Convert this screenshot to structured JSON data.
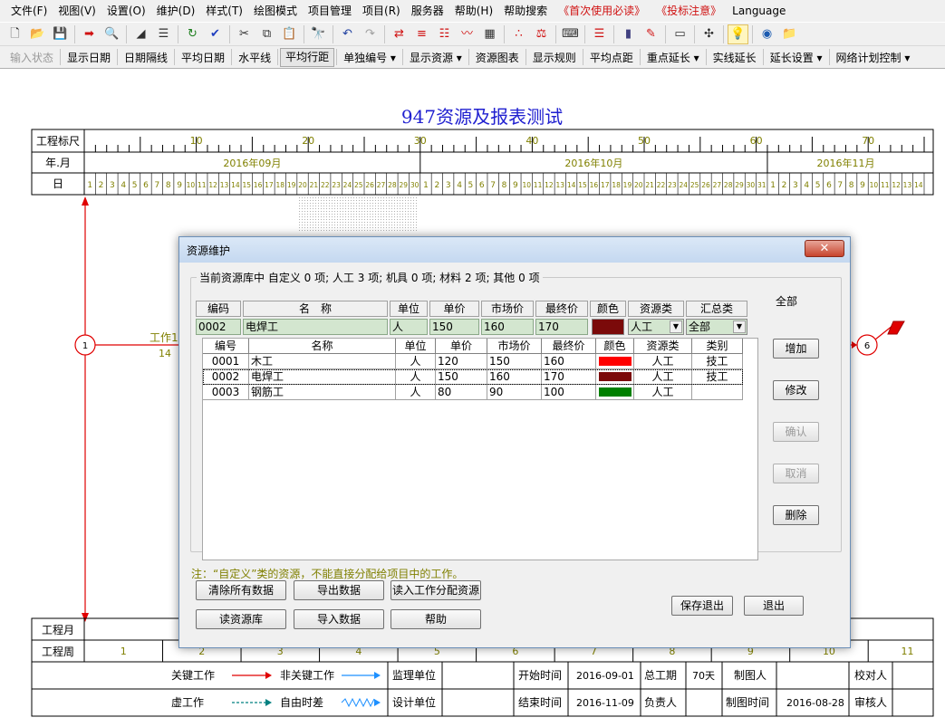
{
  "menu": {
    "items": [
      {
        "label": "文件(F)",
        "red": false
      },
      {
        "label": "视图(V)",
        "red": false
      },
      {
        "label": "设置(O)",
        "red": false
      },
      {
        "label": "维护(D)",
        "red": false
      },
      {
        "label": "样式(T)",
        "red": false
      },
      {
        "label": "绘图模式",
        "red": false
      },
      {
        "label": "项目管理",
        "red": false
      },
      {
        "label": "项目(R)",
        "red": false
      },
      {
        "label": "服务器",
        "red": false
      },
      {
        "label": "帮助(H)",
        "red": false
      },
      {
        "label": "帮助搜索",
        "red": false
      },
      {
        "label": "《首次使用必读》",
        "red": true
      },
      {
        "label": "《投标注意》",
        "red": true
      },
      {
        "label": "Language",
        "red": false
      }
    ]
  },
  "toolbar1": {
    "icons": [
      "new-icon",
      "open-icon",
      "save-icon",
      "|",
      "export-icon",
      "preview-icon",
      "|",
      "line-style-icon",
      "indent-icon",
      "|",
      "refresh-icon",
      "check-icon",
      "|",
      "cut-icon",
      "copy-icon",
      "paste-icon",
      "|",
      "find-icon",
      "|",
      "undo-icon",
      "redo-icon",
      "|",
      "network-icon",
      "layer-icon",
      "list-icon",
      "curve-icon",
      "resource-icon",
      "|",
      "calc-icon",
      "balance-icon",
      "|",
      "tool-icon",
      "|",
      "gantt-icon",
      "|",
      "chart-icon",
      "edit-icon",
      "|",
      "monitor-icon",
      "|",
      "connect-icon",
      "|",
      "bulb-icon",
      "|",
      "globe-icon",
      "folder-icon"
    ]
  },
  "toolbar2": {
    "items": [
      {
        "label": "输入状态",
        "gray": true,
        "pressed": false
      },
      {
        "label": "显示日期",
        "gray": false,
        "pressed": false
      },
      {
        "label": "日期隔线",
        "gray": false,
        "pressed": false
      },
      {
        "label": "平均日期",
        "gray": false,
        "pressed": false
      },
      {
        "label": "水平线",
        "gray": false,
        "pressed": false
      },
      {
        "label": "平均行距",
        "gray": false,
        "pressed": true
      },
      {
        "label": "单独编号 ▾",
        "gray": false,
        "pressed": false
      },
      {
        "label": "显示资源 ▾",
        "gray": false,
        "pressed": false
      },
      {
        "label": "资源图表",
        "gray": false,
        "pressed": false
      },
      {
        "label": "显示规则",
        "gray": false,
        "pressed": false
      },
      {
        "label": "平均点距",
        "gray": false,
        "pressed": false
      },
      {
        "label": "重点延长 ▾",
        "gray": false,
        "pressed": false
      },
      {
        "label": "实线延长",
        "gray": false,
        "pressed": false
      },
      {
        "label": "延长设置 ▾",
        "gray": false,
        "pressed": false
      },
      {
        "label": "网络计划控制 ▾",
        "gray": false,
        "pressed": false
      }
    ]
  },
  "project": {
    "title": "947资源及报表测试",
    "ruler_label": "工程标尺",
    "ruler_ticks": [
      "10",
      "20",
      "30",
      "40",
      "50",
      "60",
      "70"
    ],
    "month_label": "年.月",
    "months": [
      "2016年09月",
      "2016年10月",
      "2016年11月"
    ],
    "day_label": "日",
    "days": [
      "1",
      "2",
      "3",
      "4",
      "5",
      "6",
      "7",
      "8",
      "9",
      "10",
      "11",
      "12",
      "13",
      "14",
      "15",
      "16",
      "17",
      "18",
      "19",
      "20",
      "21",
      "22",
      "23",
      "24",
      "25",
      "26",
      "27",
      "28",
      "29",
      "30",
      "1",
      "2",
      "3",
      "4",
      "5",
      "6",
      "7",
      "8",
      "9",
      "10",
      "11",
      "12",
      "13",
      "14",
      "15",
      "16",
      "17",
      "18",
      "19",
      "20",
      "21",
      "22",
      "23",
      "24",
      "25",
      "26",
      "27",
      "28",
      "29",
      "30",
      "31",
      "1",
      "2",
      "3",
      "4",
      "5",
      "6",
      "7",
      "8",
      "9",
      "10",
      "11",
      "12",
      "13",
      "14"
    ],
    "work_label": "工作1",
    "work_duration": "14",
    "node_start": "1",
    "node_end": "6",
    "proj_month_label": "工程月",
    "proj_week_label": "工程周",
    "weeks": [
      "1",
      "2",
      "3",
      "4",
      "5",
      "6",
      "7",
      "8",
      "9",
      "10",
      "11"
    ],
    "legend": {
      "critical": "关键工作",
      "noncritical": "非关键工作",
      "virtual": "虚工作",
      "float": "自由时差"
    },
    "info": {
      "supervise_label": "监理单位",
      "design_label": "设计单位",
      "start_label": "开始时间",
      "start_value": "2016-09-01",
      "end_label": "结束时间",
      "end_value": "2016-11-09",
      "duration_label": "总工期",
      "duration_value": "70天",
      "leader_label": "负责人",
      "drawer_label": "制图人",
      "draw_time_label": "制图时间",
      "draw_time_value": "2016-08-28",
      "checker_label": "校对人",
      "reviewer_label": "审核人"
    }
  },
  "dialog": {
    "title": "资源维护",
    "close_label": "✕",
    "group_caption": "当前资源库中 自定义 0 项; 人工 3 项; 机具 0 项; 材料 2 项; 其他 0 项",
    "edit_headers": [
      "编码",
      "名　称",
      "单位",
      "单价",
      "市场价",
      "最终价",
      "颜色",
      "资源类",
      "汇总类"
    ],
    "edit_values": {
      "code": "0002",
      "name": "电焊工",
      "unit": "人",
      "price": "150",
      "market": "160",
      "final": "170",
      "color": "#7b0a0a",
      "res_type": "人工",
      "summary": "全部"
    },
    "filter_label": "全部",
    "grid_headers": [
      "编号",
      "名称",
      "单位",
      "单价",
      "市场价",
      "最终价",
      "颜色",
      "资源类",
      "类别"
    ],
    "rows": [
      {
        "code": "0001",
        "name": "木工",
        "unit": "人",
        "price": "120",
        "market": "150",
        "final": "160",
        "color": "#ff0000",
        "type": "人工",
        "category": "技工"
      },
      {
        "code": "0002",
        "name": "电焊工",
        "unit": "人",
        "price": "150",
        "market": "160",
        "final": "170",
        "color": "#7b0a0a",
        "type": "人工",
        "category": "技工"
      },
      {
        "code": "0003",
        "name": "钢筋工",
        "unit": "人",
        "price": "80",
        "market": "90",
        "final": "100",
        "color": "#008000",
        "type": "人工",
        "category": ""
      }
    ],
    "side_buttons": {
      "add": "增加",
      "modify": "修改",
      "confirm": "确认",
      "cancel": "取消",
      "delete": "删除"
    },
    "note": "注：“自定义”类的资源，不能直接分配给项目中的工作。",
    "bottom_buttons": {
      "clear": "清除所有数据",
      "export": "导出数据",
      "read_assign": "读入工作分配资源",
      "read_lib": "读资源库",
      "import": "导入数据",
      "help": "帮助",
      "save_exit": "保存退出",
      "exit": "退出"
    }
  },
  "colors": {
    "title_blue": "#2020d0",
    "olive": "#808000",
    "critical_red": "#e00000",
    "noncritical_blue": "#1e90ff",
    "dashed_teal": "#008080"
  }
}
